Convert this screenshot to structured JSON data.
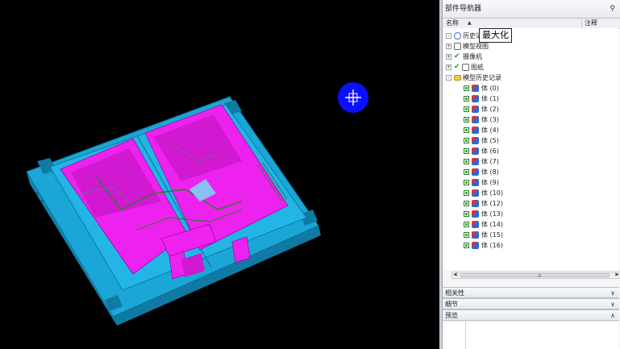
{
  "navigator": {
    "title": "部件导航器",
    "pin_icon": "pin-icon",
    "columns": {
      "name": "名称",
      "sort_icon": "sort-up-icon",
      "attr": "注释"
    },
    "tooltip": "最大化",
    "tree": {
      "top_nodes": [
        {
          "label": "历史记",
          "icon": "clock-icon",
          "expander": "-"
        },
        {
          "label": "模型视图",
          "icon": "camera-icon",
          "expander": "+"
        },
        {
          "label": "摄像机",
          "icon": "check-icon",
          "expander": "+"
        },
        {
          "label": "图纸",
          "icon": "drawing-icon",
          "expander": "+"
        },
        {
          "label": "模型历史记录",
          "icon": "folder-icon",
          "expander": "-"
        }
      ],
      "features": [
        {
          "label": "体 (0)"
        },
        {
          "label": "体 (1)"
        },
        {
          "label": "体 (2)"
        },
        {
          "label": "体 (3)"
        },
        {
          "label": "体 (4)"
        },
        {
          "label": "体 (5)"
        },
        {
          "label": "体 (6)"
        },
        {
          "label": "体 (7)"
        },
        {
          "label": "体 (8)"
        },
        {
          "label": "体 (9)"
        },
        {
          "label": "体 (10)"
        },
        {
          "label": "体 (12)"
        },
        {
          "label": "体 (13)"
        },
        {
          "label": "体 (14)"
        },
        {
          "label": "体 (15)"
        },
        {
          "label": "体 (16)"
        }
      ]
    },
    "scrollbar": {
      "grip": "III"
    },
    "panels": [
      {
        "label": "相关性",
        "chevron": "∨"
      },
      {
        "label": "细节",
        "chevron": "∨"
      },
      {
        "label": "预览",
        "chevron": "∧"
      }
    ]
  },
  "viewport": {
    "background": "#000000",
    "model_colors": {
      "base": "#1aa6d6",
      "pocket": "#ee22ee",
      "detail": "#2f7a2f"
    },
    "cursor_icon": "move-cursor-icon"
  }
}
